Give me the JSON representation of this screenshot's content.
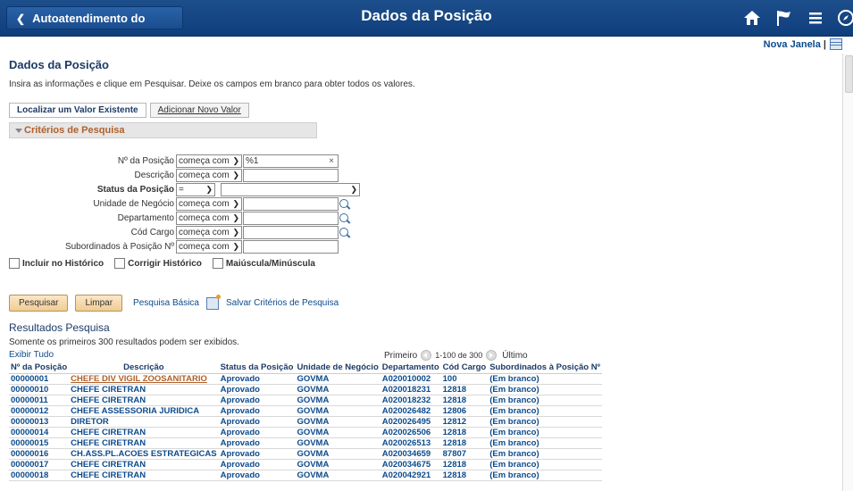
{
  "header": {
    "back_label": "Autoatendimento do Gerente",
    "title": "Dados da Posição"
  },
  "top_links": {
    "new_window": "Nova Janela"
  },
  "page": {
    "title": "Dados da Posição",
    "instructions": "Insira as informações e clique em Pesquisar. Deixe os campos em branco para obter todos os valores."
  },
  "tabs": {
    "find": "Localizar um Valor Existente",
    "add": "Adicionar Novo Valor"
  },
  "criteria": {
    "section_label": "Critérios de Pesquisa",
    "fields": [
      {
        "label": "Nº da Posição",
        "operator": "começa com",
        "value": "%1"
      },
      {
        "label": "Descrição",
        "operator": "começa com",
        "value": ""
      },
      {
        "label": "Status da Posição",
        "operator": "=",
        "value": ""
      },
      {
        "label": "Unidade de Negócio",
        "operator": "começa com",
        "value": ""
      },
      {
        "label": "Departamento",
        "operator": "começa com",
        "value": ""
      },
      {
        "label": "Cód Cargo",
        "operator": "começa com",
        "value": ""
      },
      {
        "label": "Subordinados à Posição Nº",
        "operator": "começa com",
        "value": ""
      }
    ],
    "checkboxes": [
      "Incluir no Histórico",
      "Corrigir Histórico",
      "Maiúscula/Minúscula"
    ],
    "clear_icon": "×"
  },
  "actions": {
    "search": "Pesquisar",
    "clear": "Limpar",
    "basic": "Pesquisa Básica",
    "save": "Salvar Critérios de Pesquisa"
  },
  "results": {
    "title": "Resultados Pesquisa",
    "note": "Somente os primeiros 300 resultados podem ser exibidos.",
    "show_all": "Exibir Tudo",
    "pager": {
      "first": "Primeiro",
      "range": "1-100 de 300",
      "last": "Último"
    },
    "columns": [
      "Nº da Posição",
      "Descrição",
      "Status da Posição",
      "Unidade de Negócio",
      "Departamento",
      "Cód Cargo",
      "Subordinados à Posição Nº"
    ],
    "rows": [
      [
        "00000001",
        "CHEFE DIV VIGIL ZOOSANITARIO",
        "Aprovado",
        "GOVMA",
        "A020010002",
        "100",
        "(Em branco)"
      ],
      [
        "00000010",
        "CHEFE CIRETRAN",
        "Aprovado",
        "GOVMA",
        "A020018231",
        "12818",
        "(Em branco)"
      ],
      [
        "00000011",
        "CHEFE CIRETRAN",
        "Aprovado",
        "GOVMA",
        "A020018232",
        "12818",
        "(Em branco)"
      ],
      [
        "00000012",
        "CHEFE ASSESSORIA JURIDICA",
        "Aprovado",
        "GOVMA",
        "A020026482",
        "12806",
        "(Em branco)"
      ],
      [
        "00000013",
        "DIRETOR",
        "Aprovado",
        "GOVMA",
        "A020026495",
        "12812",
        "(Em branco)"
      ],
      [
        "00000014",
        "CHEFE CIRETRAN",
        "Aprovado",
        "GOVMA",
        "A020026506",
        "12818",
        "(Em branco)"
      ],
      [
        "00000015",
        "CHEFE CIRETRAN",
        "Aprovado",
        "GOVMA",
        "A020026513",
        "12818",
        "(Em branco)"
      ],
      [
        "00000016",
        "CH.ASS.PL.ACOES ESTRATEGICAS",
        "Aprovado",
        "GOVMA",
        "A020034659",
        "87807",
        "(Em branco)"
      ],
      [
        "00000017",
        "CHEFE CIRETRAN",
        "Aprovado",
        "GOVMA",
        "A020034675",
        "12818",
        "(Em branco)"
      ],
      [
        "00000018",
        "CHEFE CIRETRAN",
        "Aprovado",
        "GOVMA",
        "A020042921",
        "12818",
        "(Em branco)"
      ]
    ]
  }
}
